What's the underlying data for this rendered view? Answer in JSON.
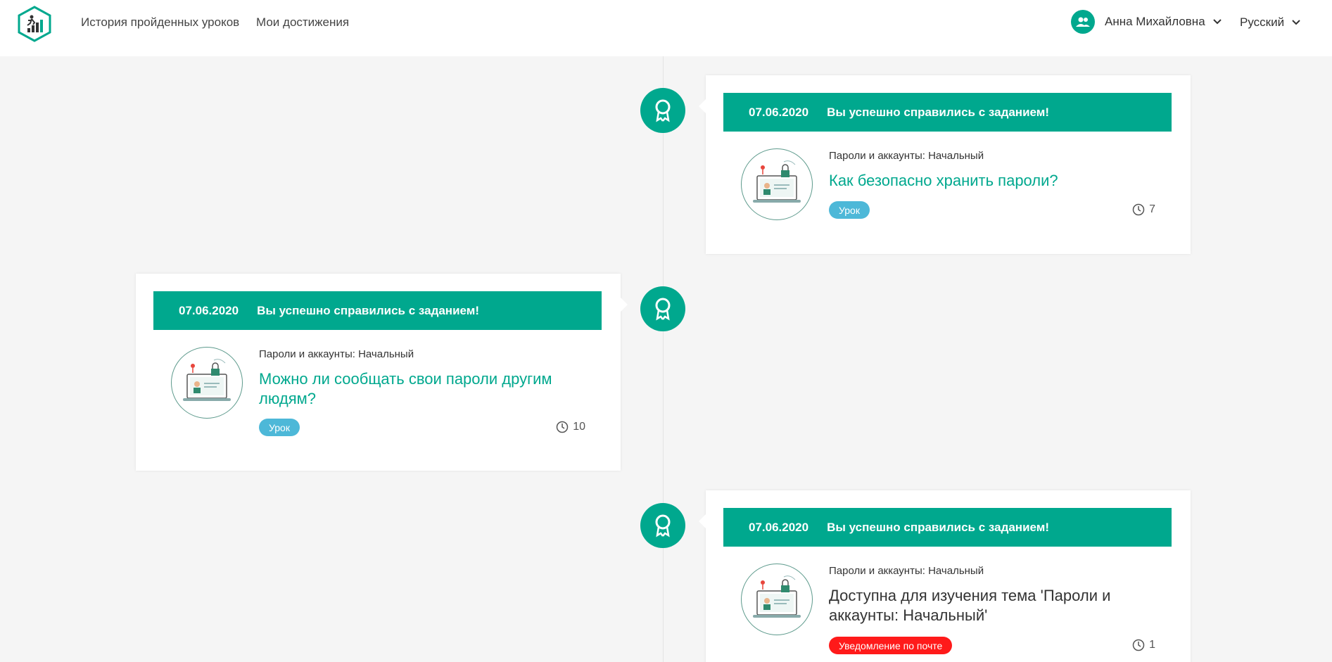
{
  "header": {
    "nav": {
      "history": "История пройденных уроков",
      "achievements": "Мои достижения"
    },
    "user_name": "Анна Михайловна",
    "language": "Русский"
  },
  "colors": {
    "accent": "#00a88e",
    "lesson_badge": "#4db8d8",
    "mail_badge": "#ff1a1a"
  },
  "events": [
    {
      "date": "07.06.2020",
      "message": "Вы успешно справились с заданием!",
      "category": "Пароли и аккаунты: Начальный",
      "title": "Как безопасно хранить пароли?",
      "badge": "Урок",
      "duration": "7",
      "icon": "award-icon"
    },
    {
      "date": "07.06.2020",
      "message": "Вы успешно справились с заданием!",
      "category": "Пароли и аккаунты: Начальный",
      "title": "Можно ли сообщать свои пароли другим людям?",
      "badge": "Урок",
      "duration": "10",
      "icon": "award-icon"
    },
    {
      "date": "07.06.2020",
      "message": "Вы успешно справились с заданием!",
      "category": "Пароли и аккаунты: Начальный",
      "title": "Доступна для изучения тема 'Пароли и аккаунты: Начальный'",
      "badge": "Уведомление по почте",
      "duration": "1",
      "icon": "award-icon"
    }
  ]
}
